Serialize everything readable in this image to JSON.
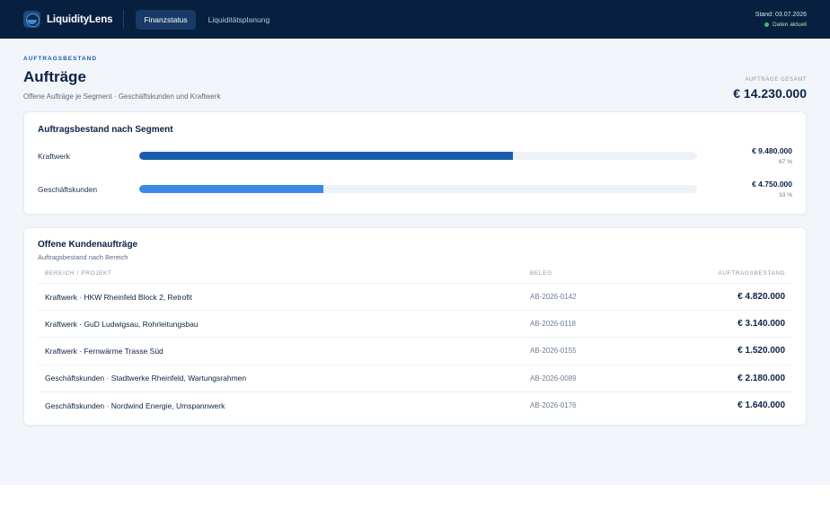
{
  "app": {
    "name": "LiquidityLens"
  },
  "nav": {
    "tabs": [
      {
        "label": "Finanzstatus"
      },
      {
        "label": "Liquiditätsplanung"
      }
    ]
  },
  "status": {
    "date": "Stand: 03.07.2026",
    "live": "Daten aktuell"
  },
  "header": {
    "eyebrow": "AUFTRAGSBESTAND",
    "title": "Aufträge",
    "subtitle": "Offene Aufträge je Segment · Geschäftskunden und Kraftwerk",
    "total_label": "AUFTRÄGE GESAMT",
    "total_value": "€ 14.230.000"
  },
  "segments": {
    "title": "Auftragsbestand nach Segment",
    "items": [
      {
        "label": "Kraftwerk",
        "amount": "€ 9.480.000",
        "percent": "67 %",
        "share": 0.67,
        "color": "#1a5cab"
      },
      {
        "label": "Geschäftskunden",
        "amount": "€ 4.750.000",
        "percent": "33 %",
        "share": 0.33,
        "color": "#3d8ae6"
      }
    ]
  },
  "orders": {
    "title": "Offene Kundenaufträge",
    "subtitle": "Auftragsbestand nach Bereich",
    "columns": [
      "BEREICH / PROJEKT",
      "BELEG",
      "AUFTRAGSBESTAND"
    ],
    "rows": [
      {
        "project": "Kraftwerk · HKW Rheinfeld Block 2, Retrofit",
        "ref": "AB-2026-0142",
        "amount": "€ 4.820.000"
      },
      {
        "project": "Kraftwerk · GuD Ludwigsau, Rohrleitungsbau",
        "ref": "AB-2026-0118",
        "amount": "€ 3.140.000"
      },
      {
        "project": "Kraftwerk · Fernwärme Trasse Süd",
        "ref": "AB-2026-0155",
        "amount": "€ 1.520.000"
      },
      {
        "project": "Geschäftskunden · Stadtwerke Rheinfeld, Wartungsrahmen",
        "ref": "AB-2026-0089",
        "amount": "€ 2.180.000"
      },
      {
        "project": "Geschäftskunden · Nordwind Energie, Umspannwerk",
        "ref": "AB-2026-0176",
        "amount": "€ 1.640.000"
      }
    ]
  }
}
